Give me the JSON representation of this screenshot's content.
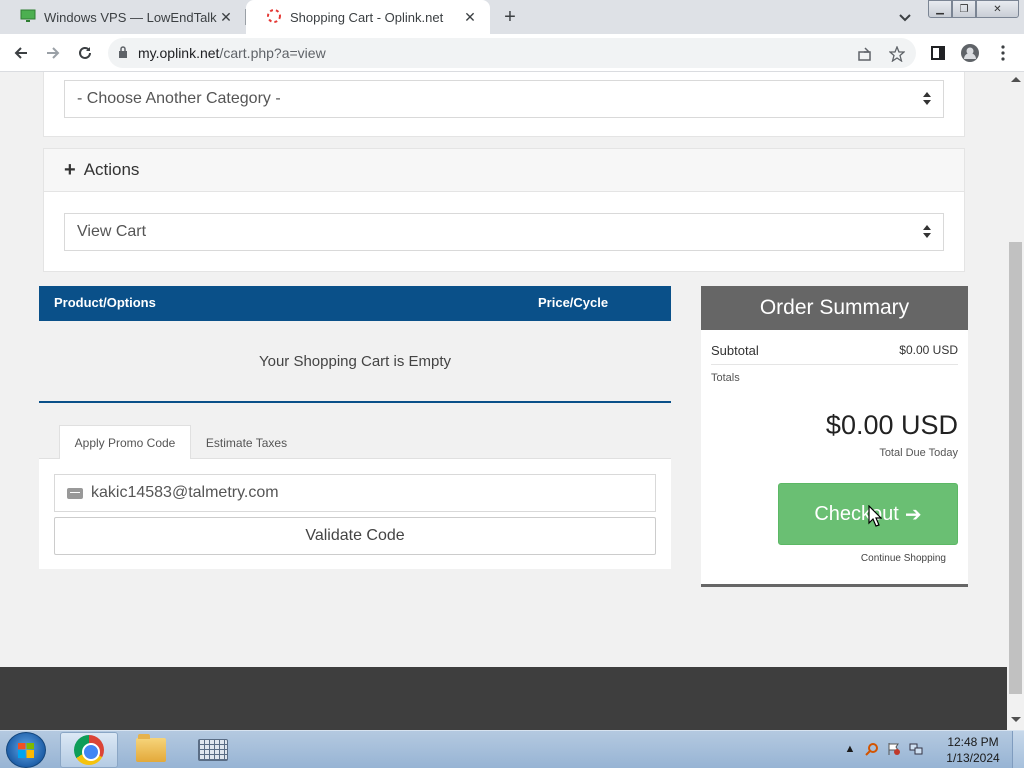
{
  "browser": {
    "tabs": [
      {
        "title": "Windows VPS — LowEndTalk",
        "icon": "monitor-icon"
      },
      {
        "title": "Shopping Cart - Oplink.net",
        "icon": "spinner-icon"
      }
    ],
    "url_host": "my.oplink.net",
    "url_path": "/cart.php?a=view"
  },
  "page": {
    "category_select": "- Choose Another Category -",
    "actions_title": "Actions",
    "actions_select": "View Cart",
    "cart": {
      "col_product": "Product/Options",
      "col_price": "Price/Cycle",
      "empty_message": "Your Shopping Cart is Empty",
      "header_color": "#0a5089"
    },
    "promo": {
      "tab_promo": "Apply Promo Code",
      "tab_taxes": "Estimate Taxes",
      "input_value": "kakic14583@talmetry.com",
      "validate_label": "Validate Code"
    },
    "summary": {
      "title": "Order Summary",
      "subtotal_label": "Subtotal",
      "subtotal_value": "$0.00 USD",
      "totals_label": "Totals",
      "total_amount": "$0.00 USD",
      "total_label": "Total Due Today",
      "checkout_label": "Checkout",
      "checkout_color": "#6abf73",
      "continue_label": "Continue Shopping"
    }
  },
  "taskbar": {
    "time": "12:48 PM",
    "date": "1/13/2024"
  }
}
